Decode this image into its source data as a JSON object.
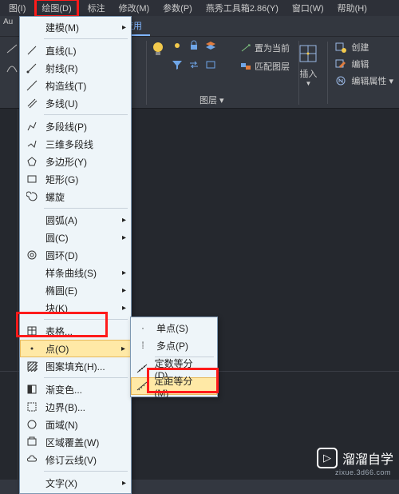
{
  "menubar": {
    "items": [
      "图(I)",
      "绘图(D)",
      "标注",
      "修改(M)",
      "参数(P)",
      "燕秀工具箱2.86(Y)",
      "窗口(W)",
      "帮助(H)"
    ]
  },
  "titlebar": {
    "aux": "Au"
  },
  "tabs": {
    "items": [
      "窗应用"
    ]
  },
  "ribbon": {
    "buttons": {
      "setCurrent": "置为当前",
      "matchLayer": "匹配图层"
    },
    "panels": {
      "layers": "图层 ▾"
    },
    "insert": {
      "label": "插入",
      "create": "创建",
      "edit": "编辑",
      "editAttr": "编辑属性 ▾"
    }
  },
  "menu": {
    "model": "建模(M)",
    "line": "直线(L)",
    "ray": "射线(R)",
    "constrLine": "构造线(T)",
    "mline": "多线(U)",
    "polyline": "多段线(P)",
    "poly3d": "三维多段线",
    "polygon": "多边形(Y)",
    "rect": "矩形(G)",
    "spiral": "螺旋",
    "arc": "圆弧(A)",
    "circle": "圆(C)",
    "donut": "圆环(D)",
    "spline": "样条曲线(S)",
    "ellipse": "椭圆(E)",
    "block": "块(K)",
    "table": "表格...",
    "point": "点(O)",
    "hatch": "图案填充(H)...",
    "gradient": "渐变色...",
    "boundary": "边界(B)...",
    "region": "面域(N)",
    "wipeout": "区域覆盖(W)",
    "revcloud": "修订云线(V)",
    "text": "文字(X)"
  },
  "submenu": {
    "single": "单点(S)",
    "multi": "多点(P)",
    "divide": "定数等分(D)",
    "measure": "定距等分(M)"
  },
  "watermark": {
    "brand": "溜溜自学",
    "url": "zixue.3d66.com"
  }
}
